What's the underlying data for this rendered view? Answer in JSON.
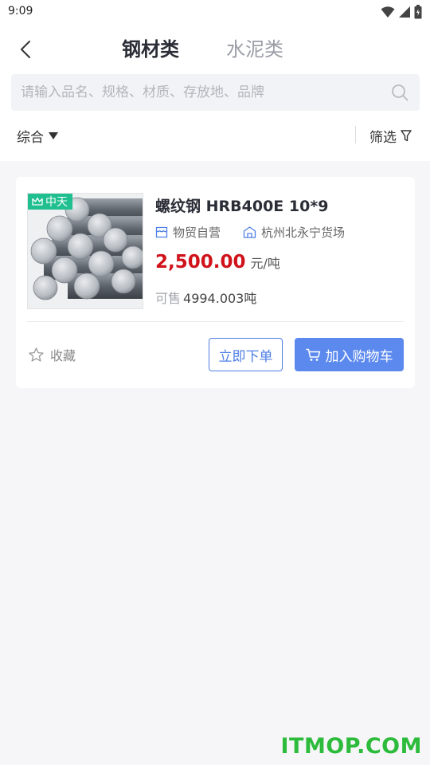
{
  "status_bar": {
    "time": "9:09"
  },
  "header": {
    "tabs": [
      {
        "label": "钢材类",
        "active": true
      },
      {
        "label": "水泥类",
        "active": false
      }
    ]
  },
  "search": {
    "placeholder": "请输入品名、规格、材质、存放地、品牌",
    "value": ""
  },
  "filters": {
    "sort_label": "综合",
    "filter_label": "筛选"
  },
  "product": {
    "badge": "中天",
    "title": "螺纹钢 HRB400E 10*9",
    "store_type": "物贸自营",
    "location": "杭州北永宁货场",
    "price": "2,500.00",
    "price_unit": "元/吨",
    "stock_label": "可售",
    "stock_value": "4994.003吨",
    "favorite_label": "收藏",
    "buy_now_label": "立即下单",
    "add_cart_label": "加入购物车"
  },
  "watermark": "ITMOP.COM",
  "colors": {
    "accent_blue": "#5b89ee",
    "price_red": "#d0121b",
    "badge_green": "#1fbf8f",
    "watermark_green": "#2dbb3c"
  },
  "icons": [
    "back-icon",
    "wifi-icon",
    "signal-icon",
    "battery-icon",
    "search-icon",
    "caret-down-icon",
    "filter-icon",
    "crown-icon",
    "store-icon",
    "warehouse-icon",
    "star-icon",
    "cart-icon"
  ]
}
